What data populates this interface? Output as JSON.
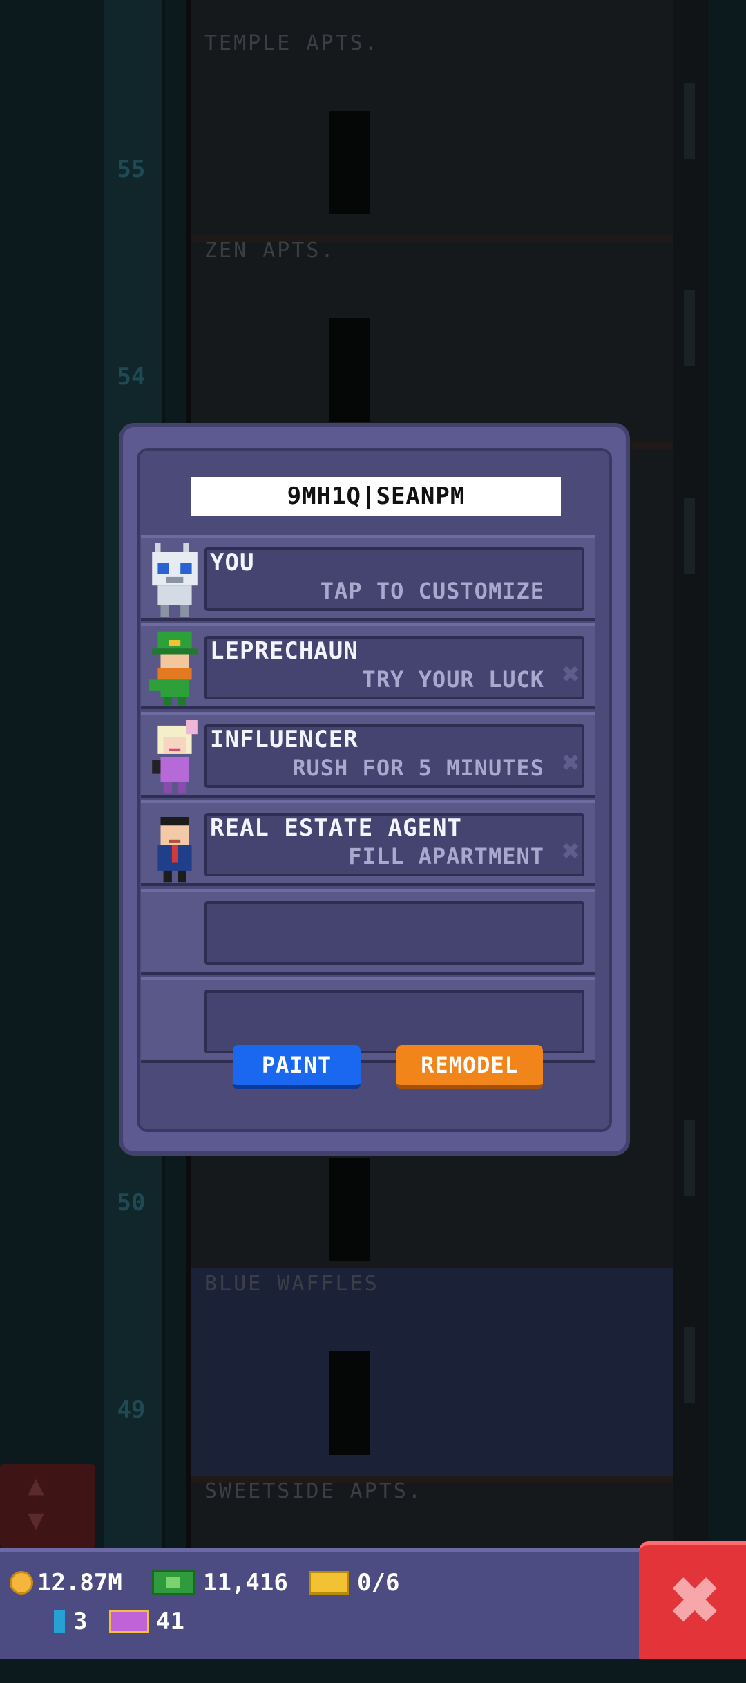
{
  "background": {
    "floor_numbers": [
      "55",
      "54",
      "50",
      "49"
    ],
    "floor_labels": [
      "TEMPLE APTS.",
      "ZEN APTS.",
      "BLUE WAFFLES",
      "SWEETSIDE APTS."
    ]
  },
  "dialog": {
    "name_value": "9MH1Q|SEANPM",
    "slots": [
      {
        "title": "YOU",
        "subtitle": "TAP TO CUSTOMIZE",
        "avatar": "robot-avatar-icon",
        "removable": false
      },
      {
        "title": "LEPRECHAUN",
        "subtitle": "TRY YOUR LUCK",
        "avatar": "leprechaun-avatar-icon",
        "removable": true
      },
      {
        "title": "INFLUENCER",
        "subtitle": "RUSH FOR 5 MINUTES",
        "avatar": "influencer-avatar-icon",
        "removable": true
      },
      {
        "title": "REAL ESTATE AGENT",
        "subtitle": "FILL APARTMENT",
        "avatar": "agent-avatar-icon",
        "removable": true
      },
      {
        "title": "",
        "subtitle": ""
      },
      {
        "title": "",
        "subtitle": ""
      }
    ],
    "remove_glyph": "✖",
    "paint_label": "PAINT",
    "remodel_label": "REMODEL"
  },
  "hud": {
    "coins": "12.87M",
    "cash": "11,416",
    "tickets": "0/6",
    "bitizens": "3",
    "vip": "41"
  },
  "close_glyph": "✖",
  "elevator_glyph_up": "▲",
  "elevator_glyph_down": "▼",
  "colors": {
    "paint_button": "#1a67f0",
    "remodel_button": "#f2851a",
    "close_button": "#e3343a",
    "dialog": "#5c5a91"
  }
}
